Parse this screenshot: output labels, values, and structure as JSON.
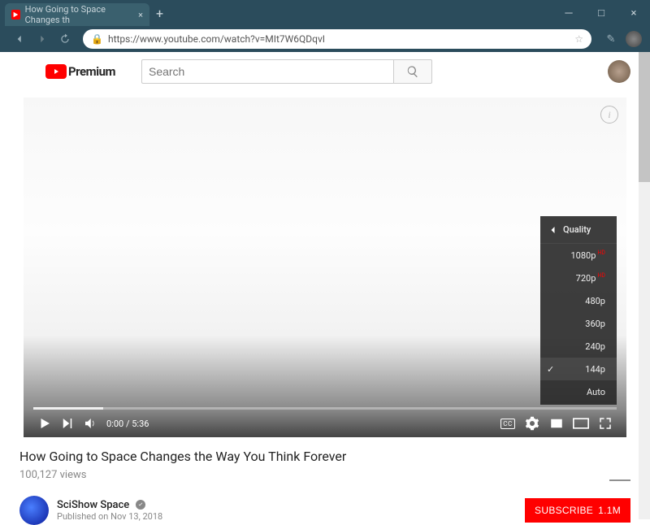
{
  "browser": {
    "tab_title": "How Going to Space Changes th",
    "url": "https://www.youtube.com/watch?v=MIt7W6QDqvI"
  },
  "yt_header": {
    "logo_text": "Premium",
    "search_placeholder": "Search"
  },
  "player": {
    "time_elapsed": "0:00",
    "time_total": "5:36",
    "quality_menu": {
      "title": "Quality",
      "options": [
        "1080p",
        "720p",
        "480p",
        "360p",
        "240p",
        "144p",
        "Auto"
      ],
      "hd_flags": [
        true,
        true,
        false,
        false,
        false,
        false,
        false
      ],
      "selected": "144p"
    }
  },
  "video": {
    "title": "How Going to Space Changes the Way You Think Forever",
    "views": "100,127 views"
  },
  "channel": {
    "name": "SciShow Space",
    "published": "Published on Nov 13, 2018"
  },
  "subscribe": {
    "label": "SUBSCRIBE",
    "count": "1.1M"
  }
}
